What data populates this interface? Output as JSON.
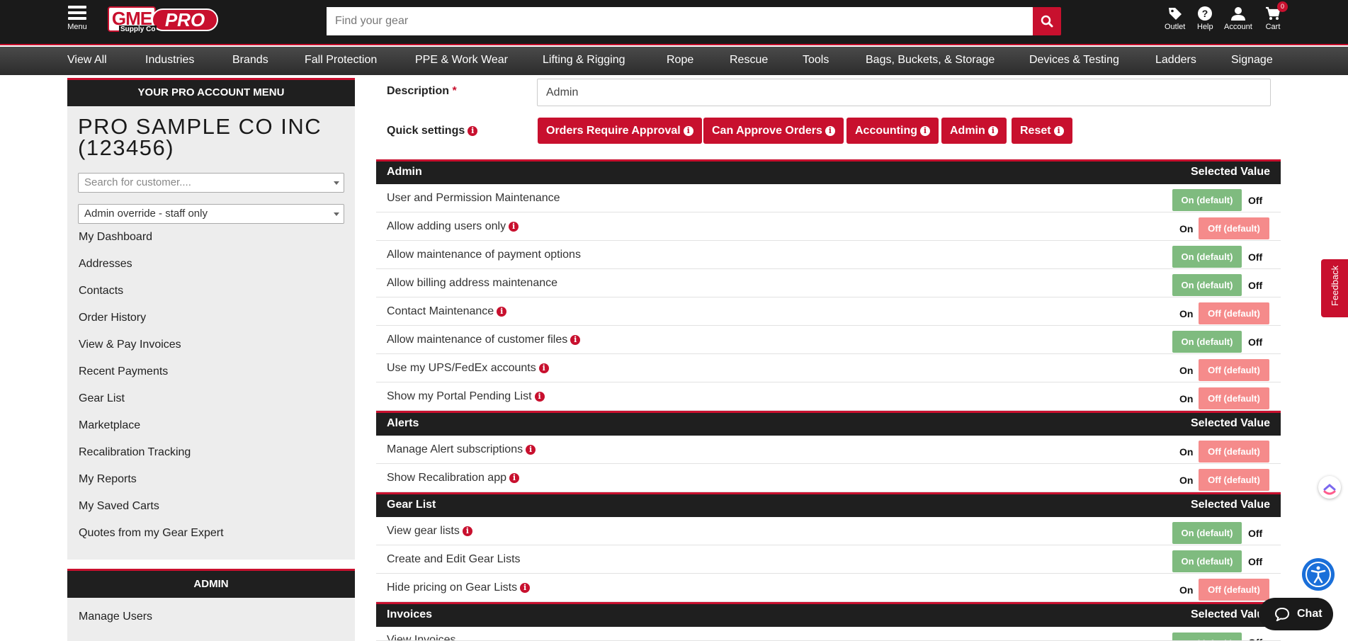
{
  "header": {
    "menu_label": "Menu",
    "logo_text": "GME",
    "logo_sub": "Supply Co",
    "logo_pro": "PRO",
    "search_placeholder": "Find your gear",
    "links": {
      "outlet": "Outlet",
      "help": "Help",
      "account": "Account",
      "cart": "Cart"
    },
    "cart_count": "0"
  },
  "catnav": [
    "View All",
    "Industries",
    "Brands",
    "Fall Protection",
    "PPE & Work Wear",
    "Lifting & Rigging",
    "Rope",
    "Rescue",
    "Tools",
    "Bags, Buckets, & Storage",
    "Devices & Testing",
    "Ladders",
    "Signage"
  ],
  "sidebar": {
    "title": "YOUR PRO ACCOUNT MENU",
    "account_name": "PRO SAMPLE CO INC (123456)",
    "customer_search_placeholder": "Search for customer....",
    "override_value": "Admin override - staff only",
    "items": [
      "My Dashboard",
      "Addresses",
      "Contacts",
      "Order History",
      "View & Pay Invoices",
      "Recent Payments",
      "Gear List",
      "Marketplace",
      "Recalibration Tracking",
      "My Reports",
      "My Saved Carts",
      "Quotes from my Gear Expert"
    ],
    "admin_title": "ADMIN",
    "admin_items": [
      "Manage Users"
    ]
  },
  "form": {
    "description_label": "Description",
    "required_mark": "*",
    "description_value": "Admin",
    "quick_settings_label": "Quick settings",
    "quick_buttons": [
      "Orders Require Approval",
      "Can Approve Orders",
      "Accounting",
      "Admin",
      "Reset"
    ]
  },
  "toggle_text": {
    "on_default": "On (default)",
    "off_default": "Off (default)",
    "on": "On",
    "off": "Off"
  },
  "sections": [
    {
      "title": "Admin",
      "value_header": "Selected Value",
      "rows": [
        {
          "label": "User and Permission Maintenance",
          "info": false,
          "value": "On (default)"
        },
        {
          "label": "Allow adding users only",
          "info": true,
          "value": "Off (default)"
        },
        {
          "label": "Allow maintenance of payment options",
          "info": false,
          "value": "On (default)"
        },
        {
          "label": "Allow billing address maintenance",
          "info": false,
          "value": "On (default)"
        },
        {
          "label": "Contact Maintenance",
          "info": true,
          "value": "Off (default)"
        },
        {
          "label": "Allow maintenance of customer files",
          "info": true,
          "value": "On (default)"
        },
        {
          "label": "Use my UPS/FedEx accounts",
          "info": true,
          "value": "Off (default)"
        },
        {
          "label": "Show my Portal Pending List",
          "info": true,
          "value": "Off (default)"
        }
      ]
    },
    {
      "title": "Alerts",
      "value_header": "Selected Value",
      "rows": [
        {
          "label": "Manage Alert subscriptions",
          "info": true,
          "value": "Off (default)"
        },
        {
          "label": "Show Recalibration app",
          "info": true,
          "value": "Off (default)"
        }
      ]
    },
    {
      "title": "Gear List",
      "value_header": "Selected Value",
      "rows": [
        {
          "label": "View gear lists",
          "info": true,
          "value": "On (default)"
        },
        {
          "label": "Create and Edit Gear Lists",
          "info": false,
          "value": "On (default)"
        },
        {
          "label": "Hide pricing on Gear Lists",
          "info": true,
          "value": "Off (default)"
        }
      ]
    },
    {
      "title": "Invoices",
      "value_header": "Selected Value",
      "rows": [
        {
          "label": "View Invoices",
          "info": false,
          "value": "On (default)"
        }
      ]
    }
  ],
  "floating": {
    "feedback": "Feedback",
    "chat": "Chat"
  },
  "colors": {
    "brand_red": "#c8102e",
    "header_dark": "#1a1a1a",
    "on_default_green": "#7fbb7f",
    "off_default_pink": "#f58b8b",
    "accessibility_blue": "#1a6fd9"
  }
}
